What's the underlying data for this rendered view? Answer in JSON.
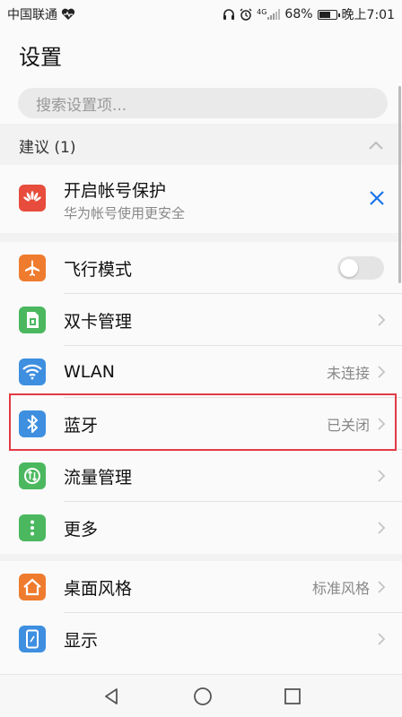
{
  "status_bar": {
    "carrier": "中国联通",
    "network": "4G",
    "battery": "68%",
    "battery_level": 0.68,
    "time": "晚上7:01"
  },
  "header": {
    "title": "设置"
  },
  "search": {
    "placeholder": "搜索设置项..."
  },
  "suggestions": {
    "title": "建议 (1)",
    "item": {
      "title": "开启帐号保护",
      "subtitle": "华为帐号使用更安全",
      "icon": "huawei-logo-icon"
    }
  },
  "settings": [
    {
      "label": "飞行模式",
      "value": "",
      "icon": "airplane-icon",
      "color": "#ef7b2e",
      "control": "toggle",
      "toggle_on": false
    },
    {
      "label": "双卡管理",
      "value": "",
      "icon": "sim-card-icon",
      "color": "#4bb85f",
      "control": "chevron"
    },
    {
      "label": "WLAN",
      "value": "未连接",
      "icon": "wifi-icon",
      "color": "#3e8fe0",
      "control": "chevron"
    },
    {
      "label": "蓝牙",
      "value": "已关闭",
      "icon": "bluetooth-icon",
      "color": "#3e8fe0",
      "control": "chevron",
      "highlighted": true
    },
    {
      "label": "流量管理",
      "value": "",
      "icon": "data-usage-icon",
      "color": "#4bb85f",
      "control": "chevron"
    },
    {
      "label": "更多",
      "value": "",
      "icon": "more-icon",
      "color": "#4bb85f",
      "control": "chevron"
    }
  ],
  "settings_2": [
    {
      "label": "桌面风格",
      "value": "标准风格",
      "icon": "home-icon",
      "color": "#ef7b2e",
      "control": "chevron"
    },
    {
      "label": "显示",
      "value": "",
      "icon": "display-icon",
      "color": "#3e8fe0",
      "control": "chevron"
    }
  ],
  "colors": {
    "highlight": "#e23a45",
    "accent": "#1a73e8"
  }
}
